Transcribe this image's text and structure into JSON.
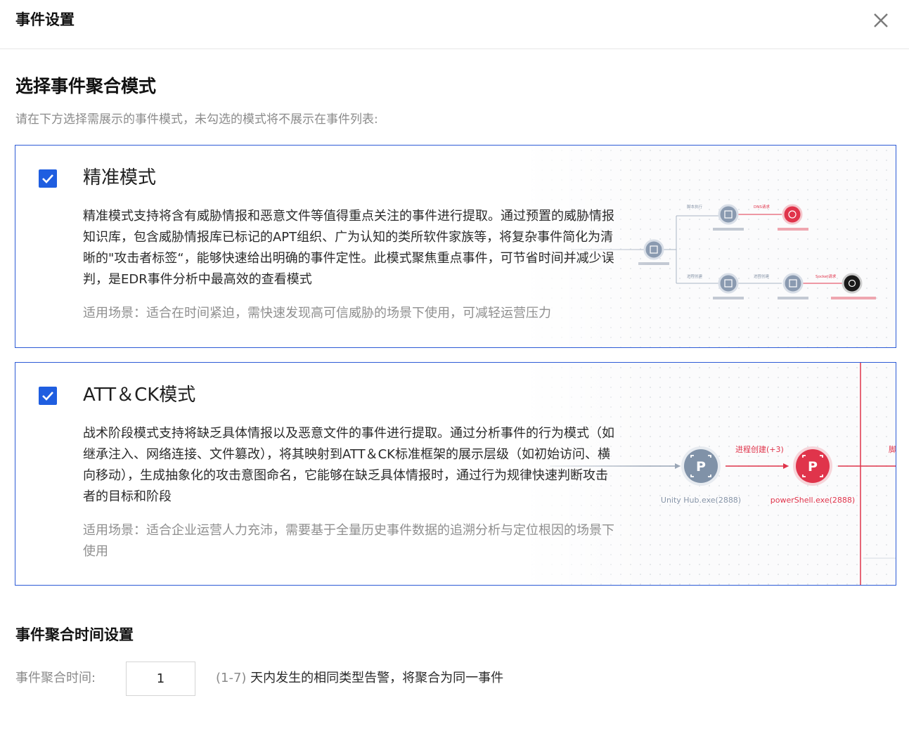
{
  "dialog": {
    "title": "事件设置",
    "close_label": "×"
  },
  "aggregation_mode": {
    "title": "选择事件聚合模式",
    "subtitle": "请在下方选择需展示的事件模式，未勾选的模式将不展示在事件列表:",
    "modes": [
      {
        "title": "精准模式",
        "checked": true,
        "description": "精准模式支持将含有威胁情报和恶意文件等值得重点关注的事件进行提取。通过预置的威胁情报知识库，包含威胁情报库已标记的APT组织、广为认知的类所软件家族等，将复杂事件简化为清晰的\"攻击者标签“，能够快速给出明确的事件定性。此模式聚焦重点事件，可节省时间并减少误判，是EDR事件分析中最高效的查看模式",
        "scenario": "适用场景：适合在时间紧迫，需快速发现高可信威胁的场景下使用，可减轻运营压力",
        "graphic_labels": [
          "脚本执行",
          "DNS请求",
          "进程创建",
          "进程创建",
          "Socket请求"
        ]
      },
      {
        "title": "ATT＆CK模式",
        "checked": true,
        "description": "战术阶段模式支持将缺乏具体情报以及恶意文件的事件进行提取。通过分析事件的行为模式（如继承注入、网络连接、文件篡改），将其映射到ATT＆CK标准框架的展示层级（如初始访问、横向移动），生成抽象化的攻击意图命名，它能够在缺乏具体情报时，通过行为规律快速判断攻击者的目标和阶段",
        "scenario": "适用场景：适合企业运营人力充沛，需要基于全量历史事件数据的追溯分析与定位根因的场景下使用",
        "graphic_labels": {
          "edge": "进程创建(+3)",
          "node_a": "Unity Hub.exe(2888)",
          "node_b": "powerShell.exe(2888)",
          "node_icon": "P",
          "cut_label": "脚"
        }
      }
    ]
  },
  "aggregation_time": {
    "title": "事件聚合时间设置",
    "label": "事件聚合时间:",
    "value": "1",
    "hint_range": "(1-7)",
    "hint_text": " 天内发生的相同类型告警，将聚合为同一事件"
  },
  "colors": {
    "accent": "#1f5ee0",
    "card_border": "#2d5bd6",
    "node_gray": "#7d8fa7",
    "node_red": "#e0344b",
    "node_dark": "#1a1a1a"
  }
}
